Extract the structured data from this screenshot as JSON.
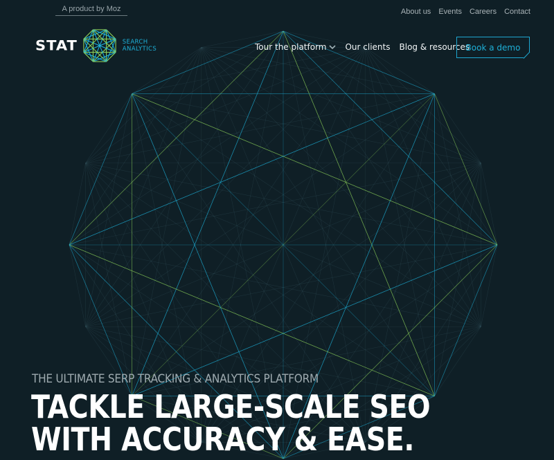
{
  "brand": {
    "tagline": "A product by Moz",
    "logo_word": "STAT",
    "logo_sub_line1": "SEARCH",
    "logo_sub_line2": "ANALYTICS",
    "accent_color": "#1eb0d8",
    "accent_green": "#8cd05a",
    "background_color": "#0f1f26"
  },
  "utility_nav": {
    "items": [
      {
        "label": "About us"
      },
      {
        "label": "Events"
      },
      {
        "label": "Careers"
      },
      {
        "label": "Contact"
      }
    ]
  },
  "main_nav": {
    "items": [
      {
        "label": "Tour the platform",
        "icon": "chevron-down-icon"
      },
      {
        "label": "Our clients"
      },
      {
        "label": "Blog & resources"
      }
    ],
    "cta_label": "Book a demo"
  },
  "hero": {
    "eyebrow": "THE ULTIMATE SERP TRACKING & ANALYTICS PLATFORM",
    "headline_line1": "TACKLE LARGE-SCALE SEO",
    "headline_line2": "WITH ACCURACY & EASE."
  }
}
